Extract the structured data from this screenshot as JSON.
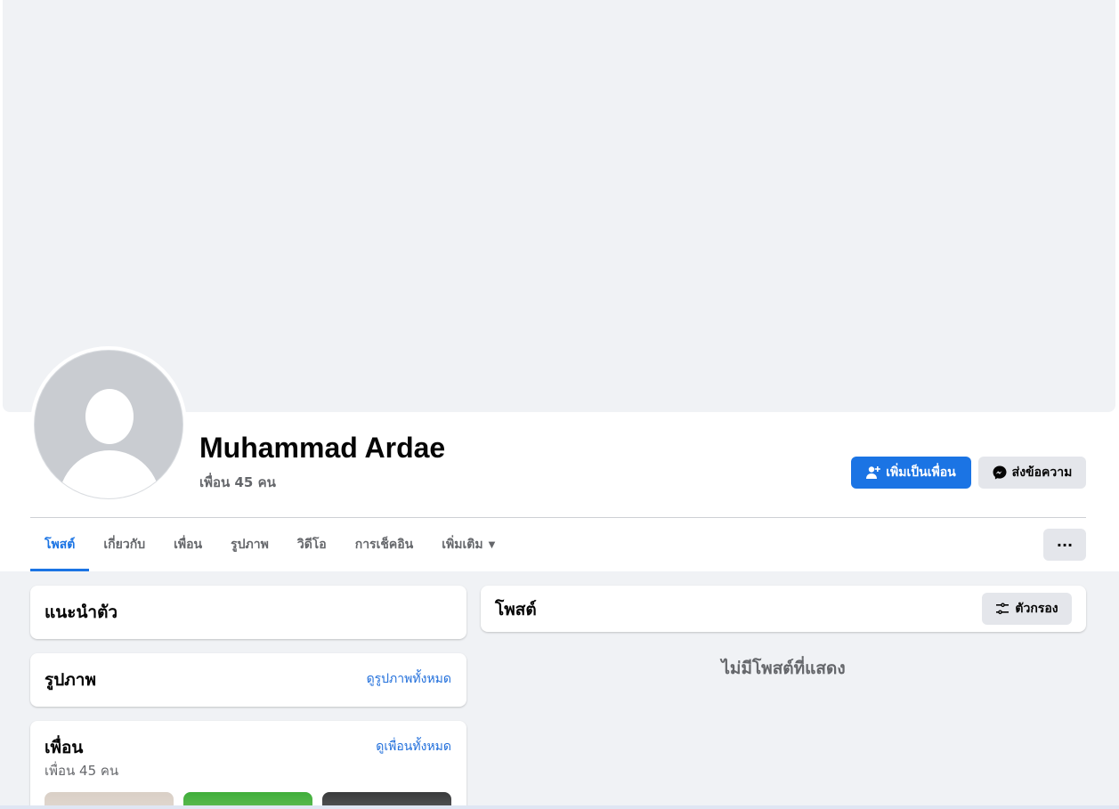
{
  "profile": {
    "name": "Muhammad Ardae",
    "friends_count": "เพื่อน 45 คน"
  },
  "actions": {
    "add_friend": "เพิ่มเป็นเพื่อน",
    "message": "ส่งข้อความ",
    "more": "···"
  },
  "tabs": [
    {
      "label": "โพสต์",
      "active": true
    },
    {
      "label": "เกี่ยวกับ"
    },
    {
      "label": "เพื่อน"
    },
    {
      "label": "รูปภาพ"
    },
    {
      "label": "วิดีโอ"
    },
    {
      "label": "การเช็คอิน"
    },
    {
      "label": "เพิ่มเติม"
    }
  ],
  "intro": {
    "title": "แนะนำตัว"
  },
  "photos": {
    "title": "รูปภาพ",
    "link": "ดูรูปภาพทั้งหมด"
  },
  "friends": {
    "title": "เพื่อน",
    "link": "ดูเพื่อนทั้งหมด",
    "subtitle": "เพื่อน 45 คน"
  },
  "posts": {
    "title": "โพสต์",
    "filter": "ตัวกรอง",
    "empty": "ไม่มีโพสต์ที่แสดง"
  },
  "colors": {
    "accent": "#1b74e4",
    "background": "#f0f2f5",
    "muted_text": "#65676b"
  }
}
